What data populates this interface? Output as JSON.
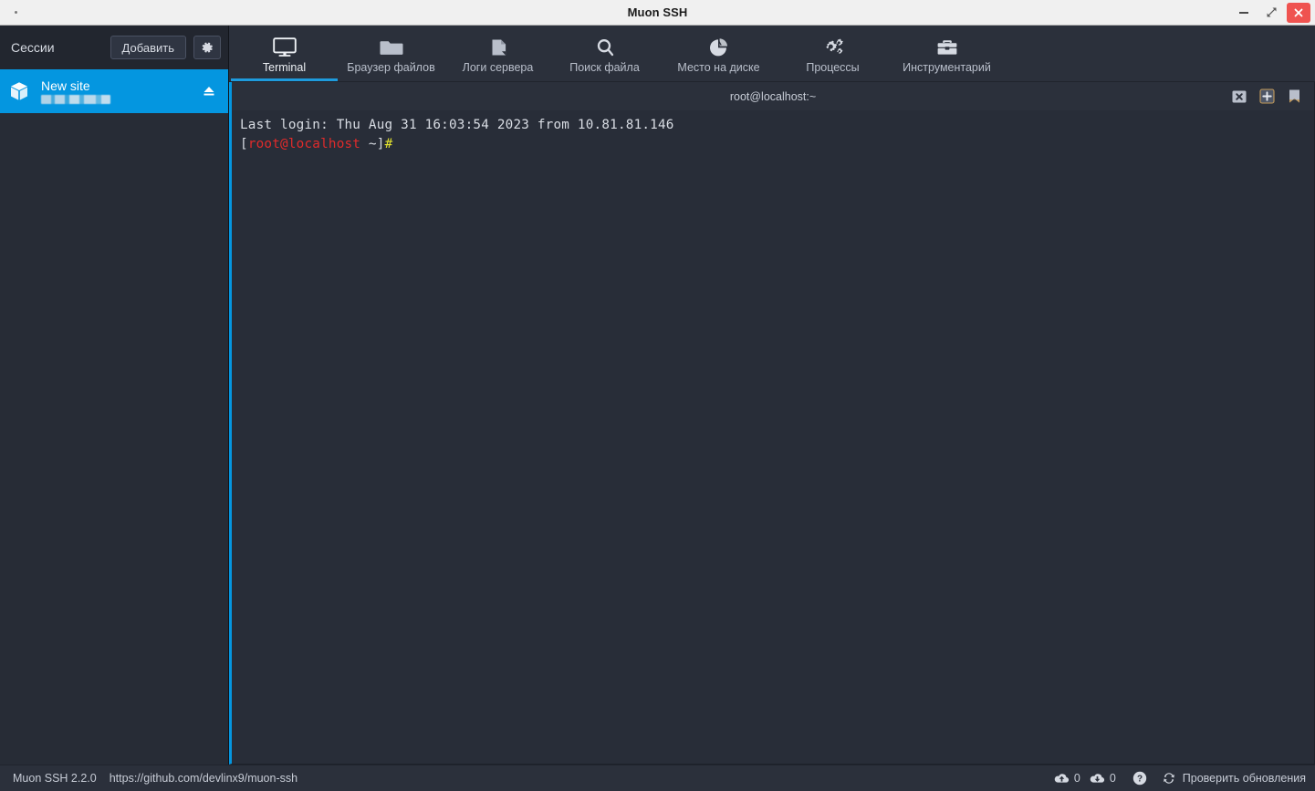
{
  "window": {
    "title": "Muon SSH",
    "controls": {
      "minimize": "minimize",
      "maximize": "maximize",
      "close": "close"
    }
  },
  "sidebar": {
    "title": "Сессии",
    "add_button": "Добавить",
    "settings_button": "",
    "sessions": [
      {
        "name": "New site",
        "subtitle_redacted": true,
        "selected": true,
        "eject_label": ""
      }
    ]
  },
  "toolbar": {
    "items": [
      {
        "label": "Terminal",
        "icon": "monitor-icon",
        "active": true
      },
      {
        "label": "Браузер файлов",
        "icon": "folder-icon",
        "active": false
      },
      {
        "label": "Логи сервера",
        "icon": "file-log-icon",
        "active": false
      },
      {
        "label": "Поиск файла",
        "icon": "search-icon",
        "active": false
      },
      {
        "label": "Место на диске",
        "icon": "pie-chart-icon",
        "active": false
      },
      {
        "label": "Процессы",
        "icon": "gears-icon",
        "active": false
      },
      {
        "label": "Инструментарий",
        "icon": "toolbox-icon",
        "active": false
      }
    ]
  },
  "terminal": {
    "tab_title": "root@localhost:~",
    "actions": [
      {
        "name": "close-tab-icon",
        "label": "x"
      },
      {
        "name": "new-tab-icon",
        "label": "+"
      },
      {
        "name": "bookmark-icon",
        "label": ""
      }
    ],
    "lines": [
      {
        "segments": [
          {
            "text": "Last login: Thu Aug 31 16:03:54 2023 from 10.81.81.146",
            "color": "white"
          }
        ]
      },
      {
        "segments": [
          {
            "text": "[",
            "color": "white"
          },
          {
            "text": "root@localhost",
            "color": "red"
          },
          {
            "text": " ~]",
            "color": "white"
          },
          {
            "text": "#",
            "color": "yellow"
          }
        ]
      }
    ],
    "line1_full": "Last login: Thu Aug 31 16:03:54 2023 from 10.81.81.146",
    "prompt_bracket_open": "[",
    "prompt_user_host": "root@localhost",
    "prompt_path_close": " ~]",
    "prompt_symbol": "#"
  },
  "statusbar": {
    "app_version": "Muon SSH 2.2.0",
    "project_url": "https://github.com/devlinx9/muon-ssh",
    "upload_count": "0",
    "download_count": "0",
    "help_label": "",
    "update_label": "Проверить обновления"
  },
  "colors": {
    "accent_blue": "#0496e0",
    "tab_underline": "#1e9bdd",
    "window_bg": "#2b303b",
    "sidebar_bg": "#272c36",
    "sidebar_header_bg": "#22262f",
    "terminal_bg": "#282d38",
    "text_primary": "#d6dae2",
    "prompt_red": "#e02b2b",
    "prompt_yellow": "#e5e52e",
    "close_button_red": "#ef5350",
    "titlebar_bg": "#f0f0f0"
  }
}
